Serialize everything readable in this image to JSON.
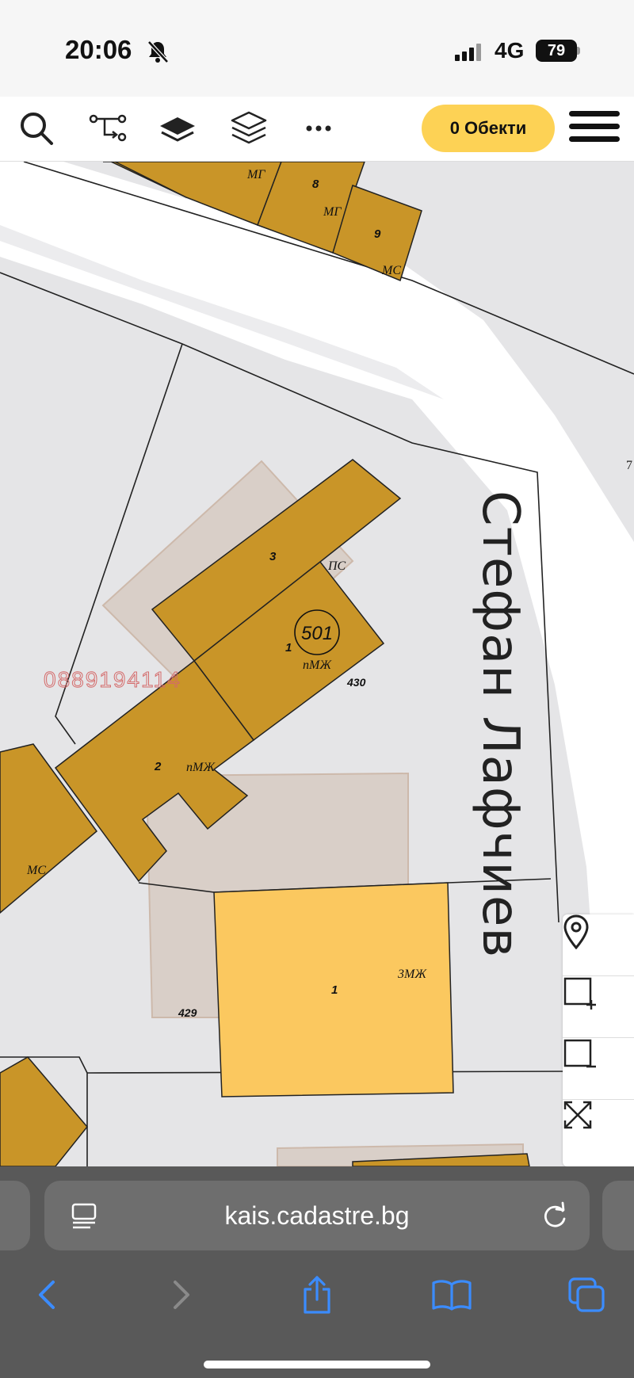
{
  "status_bar": {
    "time": "20:06",
    "network": "4G",
    "battery": "79"
  },
  "toolbar": {
    "objects_button": "0 Обекти",
    "icons": [
      "search-icon",
      "route-icon",
      "layer-icon",
      "layers-stack-icon",
      "more-icon",
      "menu-icon"
    ]
  },
  "map": {
    "street_name": "Стефан Лафчиев",
    "edge_label": "7",
    "watermark_phone": "0889194114",
    "parcel_numbers": [
      "501",
      "430",
      "429"
    ],
    "building_numbers": [
      "1",
      "2",
      "3",
      "1",
      "8",
      "9"
    ],
    "building_codes": [
      "пМЖ",
      "пМЖ",
      "ПС",
      "3МЖ",
      "МС",
      "МГ",
      "МГ",
      "МС"
    ]
  },
  "map_controls": {
    "icons": [
      "location-pin-icon",
      "add-area-icon",
      "remove-area-icon",
      "fullscreen-icon"
    ]
  },
  "browser": {
    "url": "kais.cadastre.bg",
    "colors": {
      "accent": "#3b8cff",
      "toolbar_bg": "#595959"
    }
  }
}
